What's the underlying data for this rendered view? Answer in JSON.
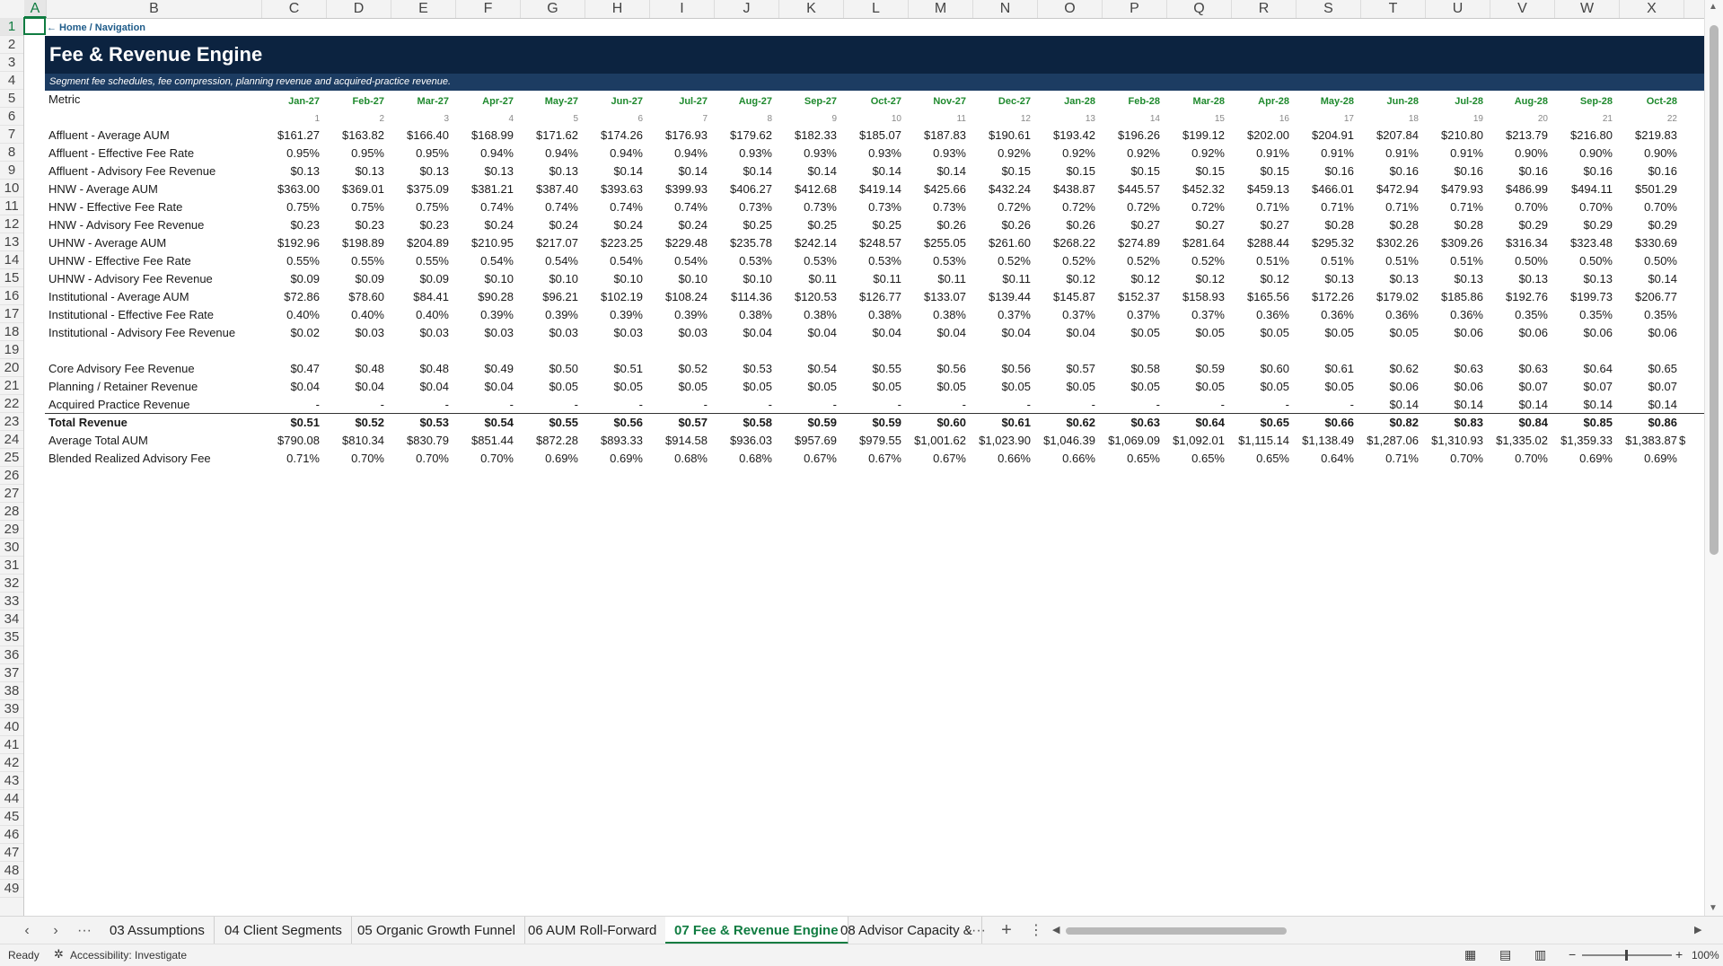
{
  "sheet": {
    "columns": [
      "A",
      "B",
      "C",
      "D",
      "E",
      "F",
      "G",
      "H",
      "I",
      "J",
      "K",
      "L",
      "M",
      "N",
      "O",
      "P",
      "Q",
      "R",
      "S",
      "T",
      "U",
      "V",
      "W",
      "X"
    ],
    "selected_column": "A",
    "selected_row": 1,
    "rows": [
      1,
      2,
      3,
      4,
      5,
      6,
      7,
      8,
      9,
      10,
      11,
      12,
      13,
      14,
      15,
      16,
      17,
      18,
      19,
      20,
      21,
      22,
      23,
      24,
      25,
      26,
      27,
      28,
      29,
      30,
      31,
      32,
      33,
      34,
      35,
      36,
      37,
      38,
      39,
      40,
      41,
      42,
      43,
      44,
      45,
      46,
      47,
      48,
      49
    ]
  },
  "nav_link": "← Home / Navigation",
  "title": "Fee & Revenue Engine",
  "subtitle": "Segment fee schedules, fee compression, planning revenue and acquired-practice revenue.",
  "metric_header": "Metric",
  "months": [
    "Jan-27",
    "Feb-27",
    "Mar-27",
    "Apr-27",
    "May-27",
    "Jun-27",
    "Jul-27",
    "Aug-27",
    "Sep-27",
    "Oct-27",
    "Nov-27",
    "Dec-27",
    "Jan-28",
    "Feb-28",
    "Mar-28",
    "Apr-28",
    "May-28",
    "Jun-28",
    "Jul-28",
    "Aug-28",
    "Sep-28",
    "Oct-28"
  ],
  "period_numbers": [
    "1",
    "2",
    "3",
    "4",
    "5",
    "6",
    "7",
    "8",
    "9",
    "10",
    "11",
    "12",
    "13",
    "14",
    "15",
    "16",
    "17",
    "18",
    "19",
    "20",
    "21",
    "22"
  ],
  "metric_rows": [
    {
      "label": "Affluent - Average AUM",
      "values": [
        "$161.27",
        "$163.82",
        "$166.40",
        "$168.99",
        "$171.62",
        "$174.26",
        "$176.93",
        "$179.62",
        "$182.33",
        "$185.07",
        "$187.83",
        "$190.61",
        "$193.42",
        "$196.26",
        "$199.12",
        "$202.00",
        "$204.91",
        "$207.84",
        "$210.80",
        "$213.79",
        "$216.80",
        "$219.83"
      ]
    },
    {
      "label": "Affluent - Effective Fee Rate",
      "values": [
        "0.95%",
        "0.95%",
        "0.95%",
        "0.94%",
        "0.94%",
        "0.94%",
        "0.94%",
        "0.93%",
        "0.93%",
        "0.93%",
        "0.93%",
        "0.92%",
        "0.92%",
        "0.92%",
        "0.92%",
        "0.91%",
        "0.91%",
        "0.91%",
        "0.91%",
        "0.90%",
        "0.90%",
        "0.90%"
      ]
    },
    {
      "label": "Affluent - Advisory Fee Revenue",
      "values": [
        "$0.13",
        "$0.13",
        "$0.13",
        "$0.13",
        "$0.13",
        "$0.14",
        "$0.14",
        "$0.14",
        "$0.14",
        "$0.14",
        "$0.14",
        "$0.15",
        "$0.15",
        "$0.15",
        "$0.15",
        "$0.15",
        "$0.16",
        "$0.16",
        "$0.16",
        "$0.16",
        "$0.16",
        "$0.16"
      ]
    },
    {
      "label": "HNW - Average AUM",
      "values": [
        "$363.00",
        "$369.01",
        "$375.09",
        "$381.21",
        "$387.40",
        "$393.63",
        "$399.93",
        "$406.27",
        "$412.68",
        "$419.14",
        "$425.66",
        "$432.24",
        "$438.87",
        "$445.57",
        "$452.32",
        "$459.13",
        "$466.01",
        "$472.94",
        "$479.93",
        "$486.99",
        "$494.11",
        "$501.29"
      ]
    },
    {
      "label": "HNW - Effective Fee Rate",
      "values": [
        "0.75%",
        "0.75%",
        "0.75%",
        "0.74%",
        "0.74%",
        "0.74%",
        "0.74%",
        "0.73%",
        "0.73%",
        "0.73%",
        "0.73%",
        "0.72%",
        "0.72%",
        "0.72%",
        "0.72%",
        "0.71%",
        "0.71%",
        "0.71%",
        "0.71%",
        "0.70%",
        "0.70%",
        "0.70%"
      ]
    },
    {
      "label": "HNW - Advisory Fee Revenue",
      "values": [
        "$0.23",
        "$0.23",
        "$0.23",
        "$0.24",
        "$0.24",
        "$0.24",
        "$0.24",
        "$0.25",
        "$0.25",
        "$0.25",
        "$0.26",
        "$0.26",
        "$0.26",
        "$0.27",
        "$0.27",
        "$0.27",
        "$0.28",
        "$0.28",
        "$0.28",
        "$0.29",
        "$0.29",
        "$0.29"
      ]
    },
    {
      "label": "UHNW - Average AUM",
      "values": [
        "$192.96",
        "$198.89",
        "$204.89",
        "$210.95",
        "$217.07",
        "$223.25",
        "$229.48",
        "$235.78",
        "$242.14",
        "$248.57",
        "$255.05",
        "$261.60",
        "$268.22",
        "$274.89",
        "$281.64",
        "$288.44",
        "$295.32",
        "$302.26",
        "$309.26",
        "$316.34",
        "$323.48",
        "$330.69"
      ]
    },
    {
      "label": "UHNW - Effective Fee Rate",
      "values": [
        "0.55%",
        "0.55%",
        "0.55%",
        "0.54%",
        "0.54%",
        "0.54%",
        "0.54%",
        "0.53%",
        "0.53%",
        "0.53%",
        "0.53%",
        "0.52%",
        "0.52%",
        "0.52%",
        "0.52%",
        "0.51%",
        "0.51%",
        "0.51%",
        "0.51%",
        "0.50%",
        "0.50%",
        "0.50%"
      ]
    },
    {
      "label": "UHNW - Advisory Fee Revenue",
      "values": [
        "$0.09",
        "$0.09",
        "$0.09",
        "$0.10",
        "$0.10",
        "$0.10",
        "$0.10",
        "$0.10",
        "$0.11",
        "$0.11",
        "$0.11",
        "$0.11",
        "$0.12",
        "$0.12",
        "$0.12",
        "$0.12",
        "$0.13",
        "$0.13",
        "$0.13",
        "$0.13",
        "$0.13",
        "$0.14"
      ]
    },
    {
      "label": "Institutional - Average AUM",
      "values": [
        "$72.86",
        "$78.60",
        "$84.41",
        "$90.28",
        "$96.21",
        "$102.19",
        "$108.24",
        "$114.36",
        "$120.53",
        "$126.77",
        "$133.07",
        "$139.44",
        "$145.87",
        "$152.37",
        "$158.93",
        "$165.56",
        "$172.26",
        "$179.02",
        "$185.86",
        "$192.76",
        "$199.73",
        "$206.77"
      ]
    },
    {
      "label": "Institutional - Effective Fee Rate",
      "values": [
        "0.40%",
        "0.40%",
        "0.40%",
        "0.39%",
        "0.39%",
        "0.39%",
        "0.39%",
        "0.38%",
        "0.38%",
        "0.38%",
        "0.38%",
        "0.37%",
        "0.37%",
        "0.37%",
        "0.37%",
        "0.36%",
        "0.36%",
        "0.36%",
        "0.36%",
        "0.35%",
        "0.35%",
        "0.35%"
      ]
    },
    {
      "label": "Institutional - Advisory Fee Revenue",
      "values": [
        "$0.02",
        "$0.03",
        "$0.03",
        "$0.03",
        "$0.03",
        "$0.03",
        "$0.03",
        "$0.04",
        "$0.04",
        "$0.04",
        "$0.04",
        "$0.04",
        "$0.04",
        "$0.05",
        "$0.05",
        "$0.05",
        "$0.05",
        "$0.05",
        "$0.06",
        "$0.06",
        "$0.06",
        "$0.06"
      ]
    }
  ],
  "summary_rows": [
    {
      "label": "Core Advisory Fee Revenue",
      "values": [
        "$0.47",
        "$0.48",
        "$0.48",
        "$0.49",
        "$0.50",
        "$0.51",
        "$0.52",
        "$0.53",
        "$0.54",
        "$0.55",
        "$0.56",
        "$0.56",
        "$0.57",
        "$0.58",
        "$0.59",
        "$0.60",
        "$0.61",
        "$0.62",
        "$0.63",
        "$0.63",
        "$0.64",
        "$0.65"
      ]
    },
    {
      "label": "Planning / Retainer Revenue",
      "values": [
        "$0.04",
        "$0.04",
        "$0.04",
        "$0.04",
        "$0.05",
        "$0.05",
        "$0.05",
        "$0.05",
        "$0.05",
        "$0.05",
        "$0.05",
        "$0.05",
        "$0.05",
        "$0.05",
        "$0.05",
        "$0.05",
        "$0.05",
        "$0.06",
        "$0.06",
        "$0.07",
        "$0.07",
        "$0.07"
      ]
    },
    {
      "label": "Acquired Practice Revenue",
      "values": [
        "-",
        "-",
        "-",
        "-",
        "-",
        "-",
        "-",
        "-",
        "-",
        "-",
        "-",
        "-",
        "-",
        "-",
        "-",
        "-",
        "-",
        "$0.14",
        "$0.14",
        "$0.14",
        "$0.14",
        "$0.14"
      ]
    }
  ],
  "total_row": {
    "label": "Total Revenue",
    "values": [
      "$0.51",
      "$0.52",
      "$0.53",
      "$0.54",
      "$0.55",
      "$0.56",
      "$0.57",
      "$0.58",
      "$0.59",
      "$0.59",
      "$0.60",
      "$0.61",
      "$0.62",
      "$0.63",
      "$0.64",
      "$0.65",
      "$0.66",
      "$0.82",
      "$0.83",
      "$0.84",
      "$0.85",
      "$0.86"
    ]
  },
  "aum_row": {
    "label": "Average Total AUM",
    "values": [
      "$790.08",
      "$810.34",
      "$830.79",
      "$851.44",
      "$872.28",
      "$893.33",
      "$914.58",
      "$936.03",
      "$957.69",
      "$979.55",
      "$1,001.62",
      "$1,023.90",
      "$1,046.39",
      "$1,069.09",
      "$1,092.01",
      "$1,115.14",
      "$1,138.49",
      "$1,287.06",
      "$1,310.93",
      "$1,335.02",
      "$1,359.33",
      "$1,383.87"
    ],
    "overflow": "$"
  },
  "blended_row": {
    "label": "Blended Realized Advisory Fee",
    "values": [
      "0.71%",
      "0.70%",
      "0.70%",
      "0.70%",
      "0.69%",
      "0.69%",
      "0.68%",
      "0.68%",
      "0.67%",
      "0.67%",
      "0.67%",
      "0.66%",
      "0.66%",
      "0.65%",
      "0.65%",
      "0.65%",
      "0.64%",
      "0.71%",
      "0.70%",
      "0.70%",
      "0.69%",
      "0.69%"
    ]
  },
  "tabs": [
    "03 Assumptions",
    "04 Client Segments",
    "05 Organic Growth Funnel",
    "06 AUM Roll-Forward",
    "07 Fee & Revenue Engine",
    "08 Advisor Capacity &"
  ],
  "active_tab": "07 Fee & Revenue Engine",
  "status": {
    "ready": "Ready",
    "accessibility": "Accessibility: Investigate",
    "zoom": "100%"
  },
  "colors": {
    "banner": "#0c2340",
    "subbanner": "#1c3c62",
    "month": "#1f8a2e",
    "accent": "#107c41"
  }
}
